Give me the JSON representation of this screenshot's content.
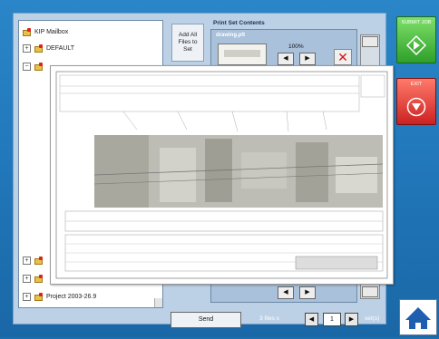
{
  "tree": {
    "items": [
      {
        "label": "KIP Mailbox",
        "expander": "",
        "level": 0
      },
      {
        "label": "DEFAULT",
        "expander": "+",
        "level": 1
      },
      {
        "label": "",
        "expander": "−",
        "level": 1
      },
      {
        "label": "",
        "expander": "+",
        "level": 1
      },
      {
        "label": "",
        "expander": "+",
        "level": 1
      },
      {
        "label": "Project 2003-26.9",
        "expander": "+",
        "level": 1
      }
    ]
  },
  "add_all": {
    "label": "Add All Files to Set"
  },
  "print_set": {
    "title": "Print Set Contents",
    "file_name": "drawing.plt",
    "zoom": "100%",
    "prev_arrow": "◀",
    "next_arrow": "▶",
    "delete_glyph": "✕"
  },
  "submit": {
    "label": "SUBMIT JOB",
    "color": "#2ea02a"
  },
  "exit": {
    "label": "EXIT",
    "color": "#cc2222"
  },
  "bottom": {
    "send_label": "Send",
    "files_count": "3 files",
    "files_sep": "x",
    "page_value": "1",
    "page_label": "set(s)"
  },
  "icons": {
    "folder": "folder-icon",
    "home": "home-icon",
    "submit": "diamond-arrow-icon",
    "exit": "stop-icon"
  }
}
